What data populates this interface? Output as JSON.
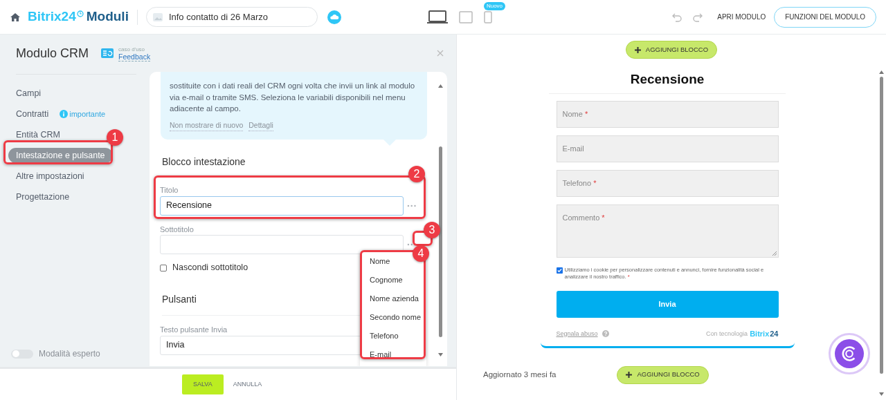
{
  "header": {
    "logo_brand": "Bitrix24",
    "logo_product": "Moduli",
    "form_name": "Info contatto di 26 Marzo",
    "devices": [
      {
        "kind": "desktop",
        "selected": true
      },
      {
        "kind": "tablet",
        "selected": false
      },
      {
        "kind": "phone",
        "selected": false,
        "badge": "Nuovo"
      }
    ],
    "open_link": "APRI MODULO",
    "functions_button": "FUNZIONI DEL MODULO"
  },
  "panel": {
    "title": "Modulo CRM",
    "use_case_label": "caso d'uso",
    "use_case_link": "Feedback",
    "sidebar": [
      {
        "label": "Campi",
        "selected": false
      },
      {
        "label": "Contratti",
        "selected": false,
        "note": "importante"
      },
      {
        "label": "Entità CRM",
        "selected": false
      },
      {
        "label": "Intestazione e pulsante",
        "selected": true
      },
      {
        "label": "Altre impostazioni",
        "selected": false
      },
      {
        "label": "Progettazione",
        "selected": false
      }
    ],
    "expert_mode": {
      "label": "Modalità esperto",
      "on": false
    },
    "hint": {
      "text": "sostituite con i dati reali del CRM ogni volta che invii un link al modulo via e-mail o tramite SMS. Seleziona le variabili disponibili nel menu adiacente al campo.",
      "links": [
        "Non mostrare di nuovo",
        "Dettagli"
      ]
    },
    "header_block": {
      "heading": "Blocco intestazione",
      "title_label": "Titolo",
      "title_value": "Recensione",
      "subtitle_label": "Sottotitolo",
      "hide_subtitle": {
        "label": "Nascondi sottotitolo",
        "checked": false
      }
    },
    "buttons_block": {
      "heading": "Pulsanti",
      "submit_label": "Testo pulsante Invia",
      "submit_value": "Invia"
    },
    "variables_menu": [
      "Nome",
      "Cognome",
      "Nome azienda",
      "Secondo nome",
      "Telefono",
      "E-mail"
    ],
    "save": "SALVA",
    "cancel": "ANNULLA"
  },
  "preview": {
    "add_block_top": "AGGIUNGI BLOCCO",
    "add_block_bottom": "AGGIUNGI BLOCCO",
    "required_mark": "*",
    "form": {
      "title": "Recensione",
      "fields": [
        {
          "label": "Nome",
          "required": true,
          "kind": "input"
        },
        {
          "label": "E-mail",
          "required": false,
          "kind": "input"
        },
        {
          "label": "Telefono",
          "required": true,
          "kind": "input"
        },
        {
          "label": "Commento",
          "required": true,
          "kind": "textarea"
        }
      ],
      "consent": {
        "text": "Utilizziamo i cookie per personalizzare contenuti e annunci, fornire funzionalità social e analizzare il nostro traffico.",
        "checked": true,
        "required": true
      },
      "submit": "Invia",
      "report_link": "Segnala abuso",
      "powered_by": "Con tecnologia",
      "brand_a": "Bitrix",
      "brand_b": "24"
    },
    "updated": "Aggiornato 3 mesi fa"
  },
  "annotations": [
    "1",
    "2",
    "3",
    "4"
  ]
}
